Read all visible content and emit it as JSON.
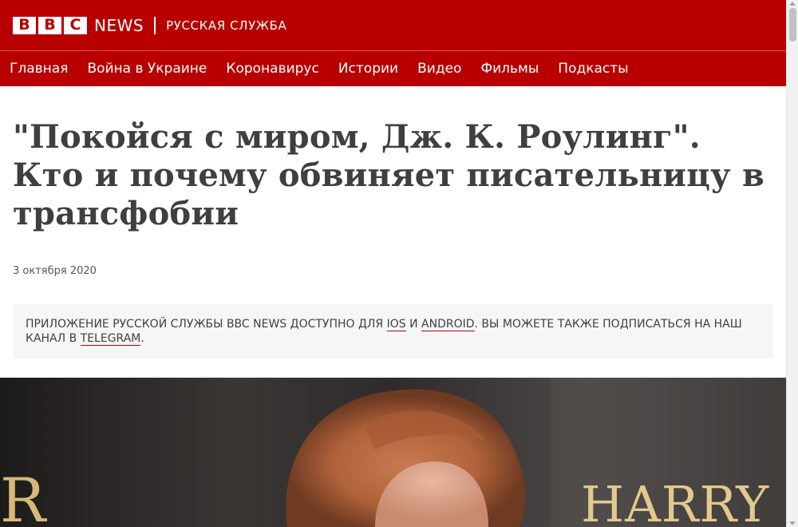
{
  "brand": {
    "bbc_letters": [
      "B",
      "B",
      "C"
    ],
    "news": "NEWS",
    "service": "РУССКАЯ СЛУЖБА",
    "color": "#b80000"
  },
  "nav": {
    "items": [
      "Главная",
      "Война в Украине",
      "Коронавирус",
      "Истории",
      "Видео",
      "Фильмы",
      "Подкасты"
    ]
  },
  "article": {
    "headline": "\"Покойся с миром, Дж. К. Роулинг\". Кто и почему обвиняет писательницу в трансфобии",
    "date": "3 октября 2020"
  },
  "promo": {
    "text_before": "ПРИЛОЖЕНИЕ РУССКОЙ СЛУЖБЫ BBC NEWS ДОСТУПНО ДЛЯ ",
    "ios": "IOS",
    "and": " И ",
    "android": "ANDROID",
    "text_middle": ". ВЫ МОЖЕТЕ ТАКЖЕ ПОДПИСАТЬСЯ НА НАШ КАНАЛ В ",
    "telegram": "TELEGRAM",
    "text_end": "."
  },
  "hero": {
    "backdrop_text_left": "R",
    "backdrop_text_right": "HARRY PO"
  }
}
